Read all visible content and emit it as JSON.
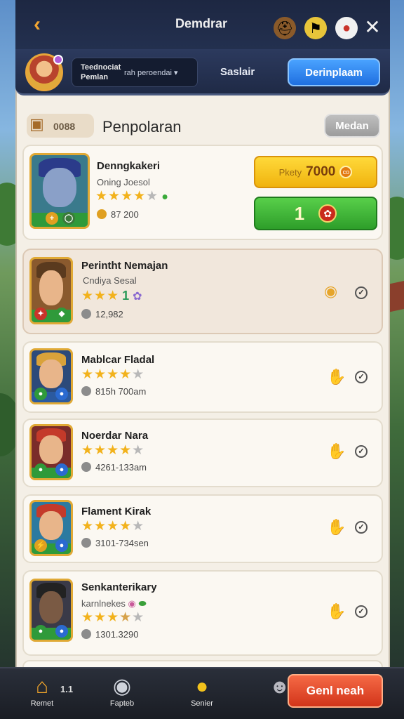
{
  "topbar": {
    "title": "Demdrar",
    "back_icon": "chevron-left-icon",
    "icons": [
      "helmet-icon",
      "flag-icon",
      "mascot-icon"
    ],
    "close_icon": "close-icon"
  },
  "profile": {
    "name": "Teednociat Pemlan",
    "select_value": "rah peroendai",
    "label": "Saslair",
    "button_label": "Derinplaam"
  },
  "section": {
    "chest_value": "0088",
    "title": "Penpolaran",
    "button_label": "Medan"
  },
  "featured": {
    "name": "Denngkakeri",
    "subtitle": "Oning Joesol",
    "stars": 4,
    "stat": "87 200",
    "price_label": "Pkety",
    "price_value": "7000",
    "price_coin": "co",
    "quantity": "1"
  },
  "heroes": [
    {
      "name": "Perintht Nemajan",
      "subtitle": "Cndiya Sesal",
      "stars": 3,
      "extra": "1",
      "stat": "12,982"
    },
    {
      "name": "Mablcar Fladal",
      "subtitle": "",
      "stars": 4,
      "extra": "",
      "stat": "815h 700am"
    },
    {
      "name": "Noerdar Nara",
      "subtitle": "",
      "stars": 4,
      "extra": "",
      "stat": "4261-133am"
    },
    {
      "name": "Flament Kirak",
      "subtitle": "",
      "stars": 4,
      "extra": "",
      "stat": "3101-734sen"
    },
    {
      "name": "Senkanterikary",
      "subtitle": "karnlnekes",
      "stars": 3,
      "extra": "",
      "stat": "1301.3290"
    }
  ],
  "nav": {
    "count": "1.1",
    "items": [
      {
        "label": "Remet",
        "icon": "house-icon"
      },
      {
        "label": "Fapteb",
        "icon": "robot-icon"
      },
      {
        "label": "Senier",
        "icon": "coin-icon"
      }
    ],
    "cta_label": "Genl neah"
  },
  "colors": {
    "accent_blue": "#1f6fe0",
    "gold": "#f0b30e",
    "green": "#2e9e2a",
    "cta_red": "#d23419"
  }
}
